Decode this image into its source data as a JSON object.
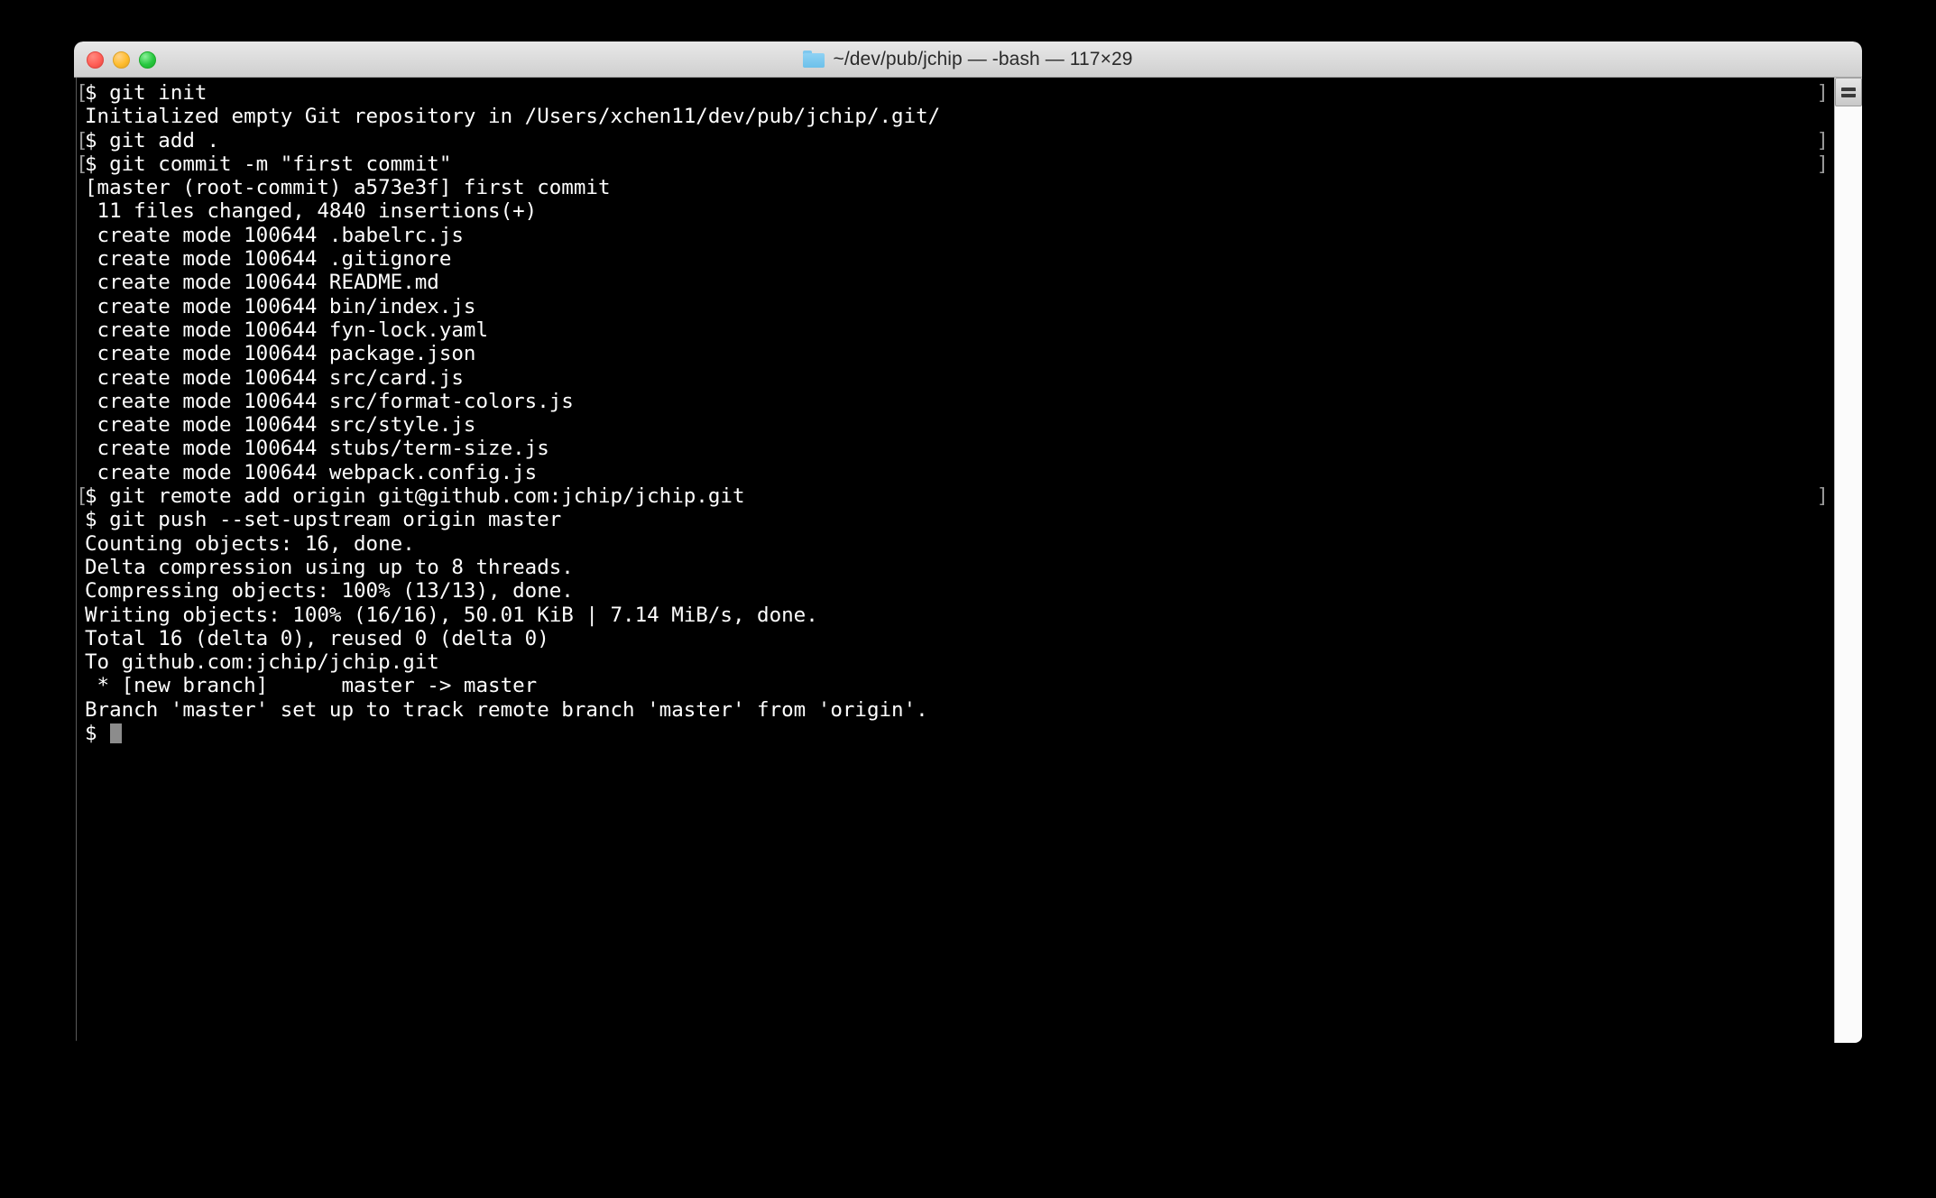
{
  "window": {
    "title": "~/dev/pub/jchip — -bash — 117×29",
    "folder_icon": "folder-icon",
    "traffic_lights": {
      "close_label": "close",
      "minimize_label": "minimize",
      "maximize_label": "maximize",
      "close_color": "#ff5f57",
      "minimize_color": "#ffbd2e",
      "maximize_color": "#28c840"
    },
    "columns": 117,
    "rows": 29,
    "shell": "-bash",
    "cwd": "~/dev/pub/jchip"
  },
  "theme": {
    "background": "#000000",
    "foreground": "#ffffff",
    "mark_color": "#9a9a9a",
    "cursor_color": "#8c8c8c",
    "titlebar_background": "#dcdcdc",
    "scrollbar_track": "#fbfbfb"
  },
  "scrollbar": {
    "thumb_label": "scroll-thumb"
  },
  "terminal": {
    "lines": [
      {
        "text": "$ git init",
        "prompt": true,
        "mark_open": "[",
        "mark_close": "]"
      },
      {
        "text": "Initialized empty Git repository in /Users/xchen11/dev/pub/jchip/.git/",
        "prompt": false
      },
      {
        "text": "$ git add .",
        "prompt": true,
        "mark_open": "[",
        "mark_close": "]"
      },
      {
        "text": "$ git commit -m \"first commit\"",
        "prompt": true,
        "mark_open": "[",
        "mark_close": "]"
      },
      {
        "text": "[master (root-commit) a573e3f] first commit",
        "prompt": false
      },
      {
        "text": " 11 files changed, 4840 insertions(+)",
        "prompt": false
      },
      {
        "text": " create mode 100644 .babelrc.js",
        "prompt": false
      },
      {
        "text": " create mode 100644 .gitignore",
        "prompt": false
      },
      {
        "text": " create mode 100644 README.md",
        "prompt": false
      },
      {
        "text": " create mode 100644 bin/index.js",
        "prompt": false
      },
      {
        "text": " create mode 100644 fyn-lock.yaml",
        "prompt": false
      },
      {
        "text": " create mode 100644 package.json",
        "prompt": false
      },
      {
        "text": " create mode 100644 src/card.js",
        "prompt": false
      },
      {
        "text": " create mode 100644 src/format-colors.js",
        "prompt": false
      },
      {
        "text": " create mode 100644 src/style.js",
        "prompt": false
      },
      {
        "text": " create mode 100644 stubs/term-size.js",
        "prompt": false
      },
      {
        "text": " create mode 100644 webpack.config.js",
        "prompt": false
      },
      {
        "text": "$ git remote add origin git@github.com:jchip/jchip.git",
        "prompt": true,
        "mark_open": "[",
        "mark_close": "]"
      },
      {
        "text": "$ git push --set-upstream origin master",
        "prompt": true
      },
      {
        "text": "Counting objects: 16, done.",
        "prompt": false
      },
      {
        "text": "Delta compression using up to 8 threads.",
        "prompt": false
      },
      {
        "text": "Compressing objects: 100% (13/13), done.",
        "prompt": false
      },
      {
        "text": "Writing objects: 100% (16/16), 50.01 KiB | 7.14 MiB/s, done.",
        "prompt": false
      },
      {
        "text": "Total 16 (delta 0), reused 0 (delta 0)",
        "prompt": false
      },
      {
        "text": "To github.com:jchip/jchip.git",
        "prompt": false
      },
      {
        "text": " * [new branch]      master -> master",
        "prompt": false
      },
      {
        "text": "Branch 'master' set up to track remote branch 'master' from 'origin'.",
        "prompt": false
      },
      {
        "text": "$ ",
        "prompt": false,
        "cursor": true
      }
    ]
  }
}
